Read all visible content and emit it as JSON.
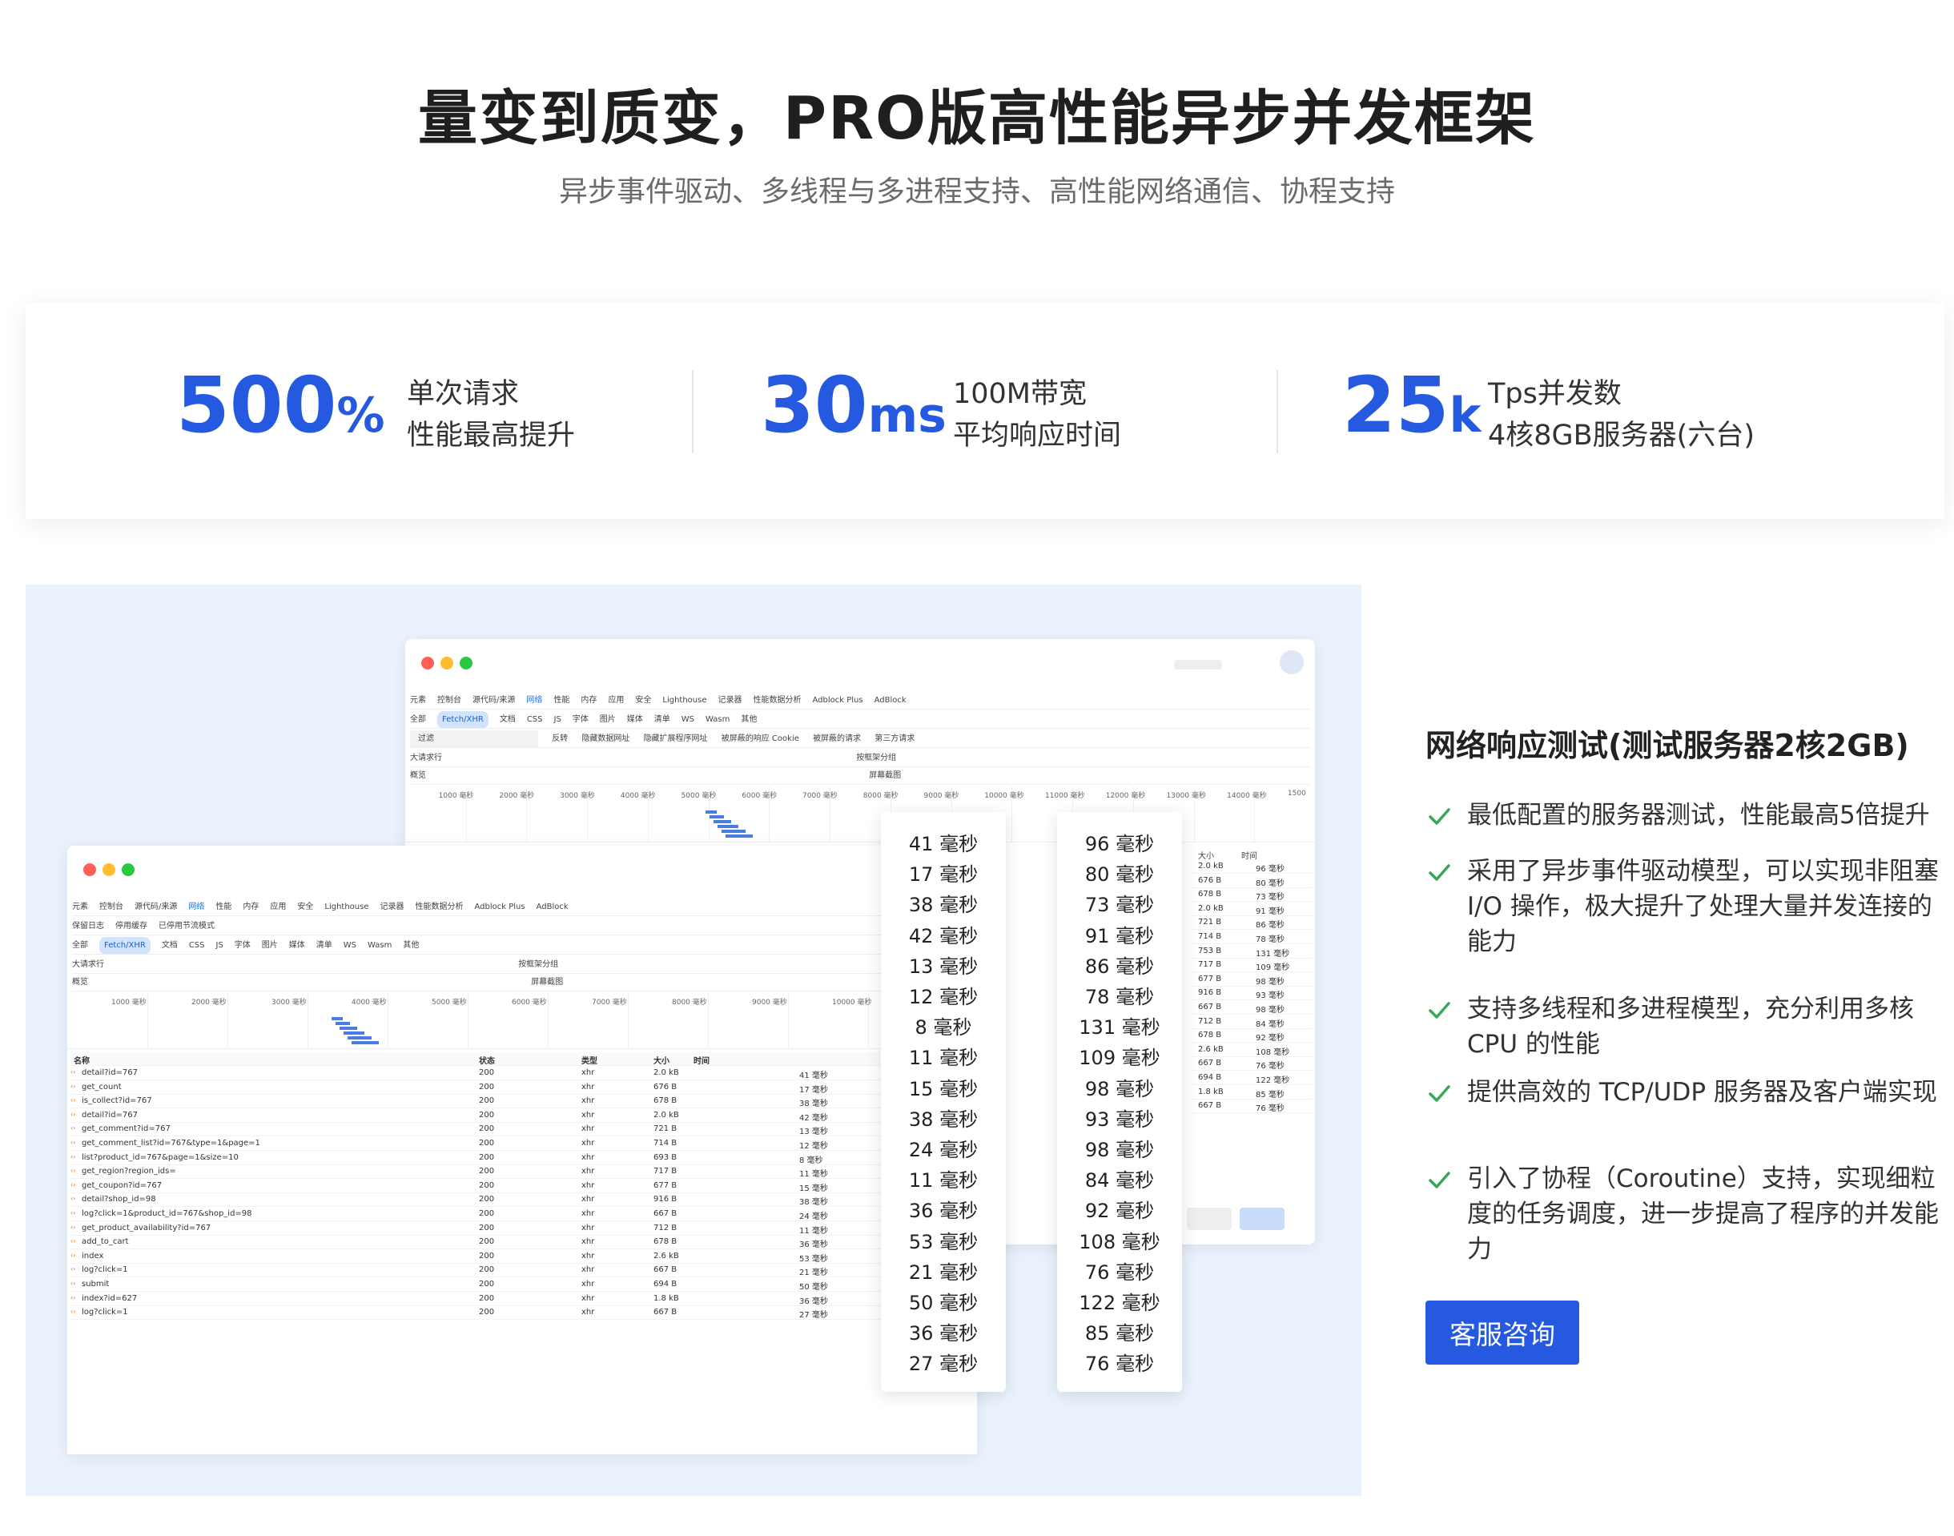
{
  "header": {
    "title": "量变到质变，PRO版高性能异步并发框架",
    "subtitle": "异步事件驱动、多线程与多进程支持、高性能网络通信、协程支持"
  },
  "stats": [
    {
      "value": "500",
      "unit": "%",
      "line1": "单次请求",
      "line2": "性能最高提升"
    },
    {
      "value": "30",
      "unit": "ms",
      "line1": "100M带宽",
      "line2": "平均响应时间"
    },
    {
      "value": "25",
      "unit": "k",
      "line1": "Tps并发数",
      "line2": "4核8GB服务器(六台)"
    }
  ],
  "devtools": {
    "tabs": [
      "元素",
      "控制台",
      "源代码/来源",
      "网络",
      "性能",
      "内存",
      "应用",
      "安全",
      "Lighthouse",
      "记录器",
      "性能数据分析",
      "Adblock Plus",
      "AdBlock"
    ],
    "active_tab": "网络",
    "filter_placeholder": "过滤",
    "filters": [
      "保留日志",
      "停用缓存",
      "已停用节流模式"
    ],
    "types": [
      "全部",
      "Fetch/XHR",
      "文档",
      "CSS",
      "JS",
      "字体",
      "图片",
      "媒体",
      "清单",
      "WS",
      "Wasm",
      "其他"
    ],
    "options": [
      "反转",
      "隐藏数据网址",
      "隐藏扩展程序网址",
      "被屏蔽的响应 Cookie",
      "被屏蔽的请求",
      "第三方请求"
    ],
    "row_options": [
      "大请求行",
      "概览",
      "按框架分组",
      "屏幕截图"
    ],
    "ticks": [
      "1000 毫秒",
      "2000 毫秒",
      "3000 毫秒",
      "4000 毫秒",
      "5000 毫秒",
      "6000 毫秒",
      "7000 毫秒",
      "8000 毫秒",
      "9000 毫秒",
      "10000 毫秒"
    ],
    "back_ticks": [
      "1000 毫秒",
      "2000 毫秒",
      "3000 毫秒",
      "4000 毫秒",
      "5000 毫秒",
      "6000 毫秒",
      "7000 毫秒",
      "8000 毫秒",
      "9000 毫秒",
      "10000 毫秒",
      "11000 毫秒",
      "12000 毫秒",
      "13000 毫秒",
      "14000 毫秒",
      "1500"
    ],
    "columns": [
      "名称",
      "状态",
      "类型",
      "大小",
      "时间"
    ],
    "rows": [
      [
        "detail?id=767",
        "200",
        "xhr",
        "2.0 kB",
        "41 毫秒"
      ],
      [
        "get_count",
        "200",
        "xhr",
        "676 B",
        "17 毫秒"
      ],
      [
        "is_collect?id=767",
        "200",
        "xhr",
        "678 B",
        "38 毫秒"
      ],
      [
        "detail?id=767",
        "200",
        "xhr",
        "2.0 kB",
        "42 毫秒"
      ],
      [
        "get_comment?id=767",
        "200",
        "xhr",
        "721 B",
        "13 毫秒"
      ],
      [
        "get_comment_list?id=767&type=1&page=1",
        "200",
        "xhr",
        "714 B",
        "12 毫秒"
      ],
      [
        "list?product_id=767&page=1&size=10",
        "200",
        "xhr",
        "693 B",
        "8 毫秒"
      ],
      [
        "get_region?region_ids=",
        "200",
        "xhr",
        "717 B",
        "11 毫秒"
      ],
      [
        "get_coupon?id=767",
        "200",
        "xhr",
        "677 B",
        "15 毫秒"
      ],
      [
        "detail?shop_id=98",
        "200",
        "xhr",
        "916 B",
        "38 毫秒"
      ],
      [
        "log?click=1&product_id=767&shop_id=98",
        "200",
        "xhr",
        "667 B",
        "24 毫秒"
      ],
      [
        "get_product_availability?id=767",
        "200",
        "xhr",
        "712 B",
        "11 毫秒"
      ],
      [
        "add_to_cart",
        "200",
        "xhr",
        "678 B",
        "36 毫秒"
      ],
      [
        "index",
        "200",
        "xhr",
        "2.6 kB",
        "53 毫秒"
      ],
      [
        "log?click=1",
        "200",
        "xhr",
        "667 B",
        "21 毫秒"
      ],
      [
        "submit",
        "200",
        "xhr",
        "694 B",
        "50 毫秒"
      ],
      [
        "index?id=627",
        "200",
        "xhr",
        "1.8 kB",
        "36 毫秒"
      ],
      [
        "log?click=1",
        "200",
        "xhr",
        "667 B",
        "27 毫秒"
      ]
    ],
    "back_rows": [
      [
        "2.0 kB",
        "96 毫秒"
      ],
      [
        "676 B",
        "80 毫秒"
      ],
      [
        "678 B",
        "73 毫秒"
      ],
      [
        "2.0 kB",
        "91 毫秒"
      ],
      [
        "721 B",
        "86 毫秒"
      ],
      [
        "714 B",
        "78 毫秒"
      ],
      [
        "753 B",
        "131 毫秒"
      ],
      [
        "717 B",
        "109 毫秒"
      ],
      [
        "677 B",
        "98 毫秒"
      ],
      [
        "916 B",
        "93 毫秒"
      ],
      [
        "667 B",
        "98 毫秒"
      ],
      [
        "712 B",
        "84 毫秒"
      ],
      [
        "678 B",
        "92 毫秒"
      ],
      [
        "2.6 kB",
        "108 毫秒"
      ],
      [
        "667 B",
        "76 毫秒"
      ],
      [
        "694 B",
        "122 毫秒"
      ],
      [
        "1.8 kB",
        "85 毫秒"
      ],
      [
        "667 B",
        "76 毫秒"
      ]
    ],
    "back_col_size": "大小",
    "back_col_time": "时间"
  },
  "bubbles": {
    "left": [
      "41 毫秒",
      "17 毫秒",
      "38 毫秒",
      "42 毫秒",
      "13 毫秒",
      "12 毫秒",
      "8 毫秒",
      "11 毫秒",
      "15 毫秒",
      "38 毫秒",
      "24 毫秒",
      "11 毫秒",
      "36 毫秒",
      "53 毫秒",
      "21 毫秒",
      "50 毫秒",
      "36 毫秒",
      "27 毫秒"
    ],
    "right": [
      "96 毫秒",
      "80 毫秒",
      "73 毫秒",
      "91 毫秒",
      "86 毫秒",
      "78 毫秒",
      "131 毫秒",
      "109 毫秒",
      "98 毫秒",
      "93 毫秒",
      "98 毫秒",
      "84 毫秒",
      "92 毫秒",
      "108 毫秒",
      "76 毫秒",
      "122 毫秒",
      "85 毫秒",
      "76 毫秒"
    ]
  },
  "features": {
    "title": "网络响应测试(测试服务器2核2GB)",
    "items": [
      "最低配置的服务器测试，性能最高5倍提升",
      "采用了异步事件驱动模型，可以实现非阻塞 I/O 操作，极大提升了处理大量并发连接的能力",
      "支持多线程和多进程模型，充分利用多核 CPU 的性能",
      "提供高效的 TCP/UDP 服务器及客户端实现",
      "引入了协程（Coroutine）支持，实现细粒度的任务调度，进一步提高了程序的并发能力"
    ],
    "cta": "客服咨询"
  },
  "colors": {
    "accent": "#2459e0",
    "check": "#3aa757",
    "panel_bg": "#e9f2fd"
  }
}
